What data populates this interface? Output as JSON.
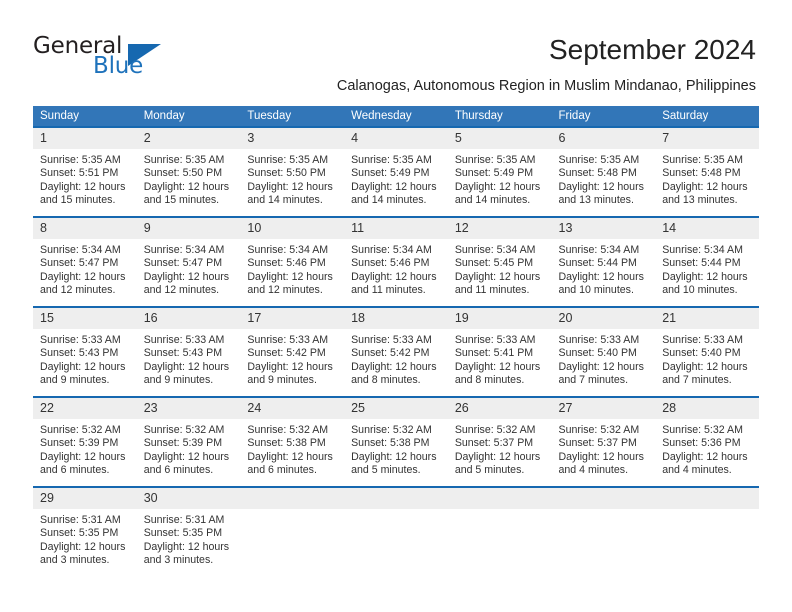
{
  "brand": {
    "word1": "General",
    "word2": "Blue",
    "logo_icon": "triangle-flag-icon",
    "accent_color": "#1668b0"
  },
  "header": {
    "month_title": "September 2024",
    "location_subtitle": "Calanogas, Autonomous Region in Muslim Mindanao, Philippines"
  },
  "calendar": {
    "header_bg": "#3276b8",
    "row_divider_color": "#1668b0",
    "daynum_bg": "#eeeeee",
    "weekday_headers": [
      "Sunday",
      "Monday",
      "Tuesday",
      "Wednesday",
      "Thursday",
      "Friday",
      "Saturday"
    ],
    "weeks": [
      [
        {
          "day": "1",
          "sunrise": "Sunrise: 5:35 AM",
          "sunset": "Sunset: 5:51 PM",
          "daylight1": "Daylight: 12 hours",
          "daylight2": "and 15 minutes."
        },
        {
          "day": "2",
          "sunrise": "Sunrise: 5:35 AM",
          "sunset": "Sunset: 5:50 PM",
          "daylight1": "Daylight: 12 hours",
          "daylight2": "and 15 minutes."
        },
        {
          "day": "3",
          "sunrise": "Sunrise: 5:35 AM",
          "sunset": "Sunset: 5:50 PM",
          "daylight1": "Daylight: 12 hours",
          "daylight2": "and 14 minutes."
        },
        {
          "day": "4",
          "sunrise": "Sunrise: 5:35 AM",
          "sunset": "Sunset: 5:49 PM",
          "daylight1": "Daylight: 12 hours",
          "daylight2": "and 14 minutes."
        },
        {
          "day": "5",
          "sunrise": "Sunrise: 5:35 AM",
          "sunset": "Sunset: 5:49 PM",
          "daylight1": "Daylight: 12 hours",
          "daylight2": "and 14 minutes."
        },
        {
          "day": "6",
          "sunrise": "Sunrise: 5:35 AM",
          "sunset": "Sunset: 5:48 PM",
          "daylight1": "Daylight: 12 hours",
          "daylight2": "and 13 minutes."
        },
        {
          "day": "7",
          "sunrise": "Sunrise: 5:35 AM",
          "sunset": "Sunset: 5:48 PM",
          "daylight1": "Daylight: 12 hours",
          "daylight2": "and 13 minutes."
        }
      ],
      [
        {
          "day": "8",
          "sunrise": "Sunrise: 5:34 AM",
          "sunset": "Sunset: 5:47 PM",
          "daylight1": "Daylight: 12 hours",
          "daylight2": "and 12 minutes."
        },
        {
          "day": "9",
          "sunrise": "Sunrise: 5:34 AM",
          "sunset": "Sunset: 5:47 PM",
          "daylight1": "Daylight: 12 hours",
          "daylight2": "and 12 minutes."
        },
        {
          "day": "10",
          "sunrise": "Sunrise: 5:34 AM",
          "sunset": "Sunset: 5:46 PM",
          "daylight1": "Daylight: 12 hours",
          "daylight2": "and 12 minutes."
        },
        {
          "day": "11",
          "sunrise": "Sunrise: 5:34 AM",
          "sunset": "Sunset: 5:46 PM",
          "daylight1": "Daylight: 12 hours",
          "daylight2": "and 11 minutes."
        },
        {
          "day": "12",
          "sunrise": "Sunrise: 5:34 AM",
          "sunset": "Sunset: 5:45 PM",
          "daylight1": "Daylight: 12 hours",
          "daylight2": "and 11 minutes."
        },
        {
          "day": "13",
          "sunrise": "Sunrise: 5:34 AM",
          "sunset": "Sunset: 5:44 PM",
          "daylight1": "Daylight: 12 hours",
          "daylight2": "and 10 minutes."
        },
        {
          "day": "14",
          "sunrise": "Sunrise: 5:34 AM",
          "sunset": "Sunset: 5:44 PM",
          "daylight1": "Daylight: 12 hours",
          "daylight2": "and 10 minutes."
        }
      ],
      [
        {
          "day": "15",
          "sunrise": "Sunrise: 5:33 AM",
          "sunset": "Sunset: 5:43 PM",
          "daylight1": "Daylight: 12 hours",
          "daylight2": "and 9 minutes."
        },
        {
          "day": "16",
          "sunrise": "Sunrise: 5:33 AM",
          "sunset": "Sunset: 5:43 PM",
          "daylight1": "Daylight: 12 hours",
          "daylight2": "and 9 minutes."
        },
        {
          "day": "17",
          "sunrise": "Sunrise: 5:33 AM",
          "sunset": "Sunset: 5:42 PM",
          "daylight1": "Daylight: 12 hours",
          "daylight2": "and 9 minutes."
        },
        {
          "day": "18",
          "sunrise": "Sunrise: 5:33 AM",
          "sunset": "Sunset: 5:42 PM",
          "daylight1": "Daylight: 12 hours",
          "daylight2": "and 8 minutes."
        },
        {
          "day": "19",
          "sunrise": "Sunrise: 5:33 AM",
          "sunset": "Sunset: 5:41 PM",
          "daylight1": "Daylight: 12 hours",
          "daylight2": "and 8 minutes."
        },
        {
          "day": "20",
          "sunrise": "Sunrise: 5:33 AM",
          "sunset": "Sunset: 5:40 PM",
          "daylight1": "Daylight: 12 hours",
          "daylight2": "and 7 minutes."
        },
        {
          "day": "21",
          "sunrise": "Sunrise: 5:33 AM",
          "sunset": "Sunset: 5:40 PM",
          "daylight1": "Daylight: 12 hours",
          "daylight2": "and 7 minutes."
        }
      ],
      [
        {
          "day": "22",
          "sunrise": "Sunrise: 5:32 AM",
          "sunset": "Sunset: 5:39 PM",
          "daylight1": "Daylight: 12 hours",
          "daylight2": "and 6 minutes."
        },
        {
          "day": "23",
          "sunrise": "Sunrise: 5:32 AM",
          "sunset": "Sunset: 5:39 PM",
          "daylight1": "Daylight: 12 hours",
          "daylight2": "and 6 minutes."
        },
        {
          "day": "24",
          "sunrise": "Sunrise: 5:32 AM",
          "sunset": "Sunset: 5:38 PM",
          "daylight1": "Daylight: 12 hours",
          "daylight2": "and 6 minutes."
        },
        {
          "day": "25",
          "sunrise": "Sunrise: 5:32 AM",
          "sunset": "Sunset: 5:38 PM",
          "daylight1": "Daylight: 12 hours",
          "daylight2": "and 5 minutes."
        },
        {
          "day": "26",
          "sunrise": "Sunrise: 5:32 AM",
          "sunset": "Sunset: 5:37 PM",
          "daylight1": "Daylight: 12 hours",
          "daylight2": "and 5 minutes."
        },
        {
          "day": "27",
          "sunrise": "Sunrise: 5:32 AM",
          "sunset": "Sunset: 5:37 PM",
          "daylight1": "Daylight: 12 hours",
          "daylight2": "and 4 minutes."
        },
        {
          "day": "28",
          "sunrise": "Sunrise: 5:32 AM",
          "sunset": "Sunset: 5:36 PM",
          "daylight1": "Daylight: 12 hours",
          "daylight2": "and 4 minutes."
        }
      ],
      [
        {
          "day": "29",
          "sunrise": "Sunrise: 5:31 AM",
          "sunset": "Sunset: 5:35 PM",
          "daylight1": "Daylight: 12 hours",
          "daylight2": "and 3 minutes."
        },
        {
          "day": "30",
          "sunrise": "Sunrise: 5:31 AM",
          "sunset": "Sunset: 5:35 PM",
          "daylight1": "Daylight: 12 hours",
          "daylight2": "and 3 minutes."
        },
        {
          "day": "",
          "sunrise": "",
          "sunset": "",
          "daylight1": "",
          "daylight2": ""
        },
        {
          "day": "",
          "sunrise": "",
          "sunset": "",
          "daylight1": "",
          "daylight2": ""
        },
        {
          "day": "",
          "sunrise": "",
          "sunset": "",
          "daylight1": "",
          "daylight2": ""
        },
        {
          "day": "",
          "sunrise": "",
          "sunset": "",
          "daylight1": "",
          "daylight2": ""
        },
        {
          "day": "",
          "sunrise": "",
          "sunset": "",
          "daylight1": "",
          "daylight2": ""
        }
      ]
    ]
  }
}
